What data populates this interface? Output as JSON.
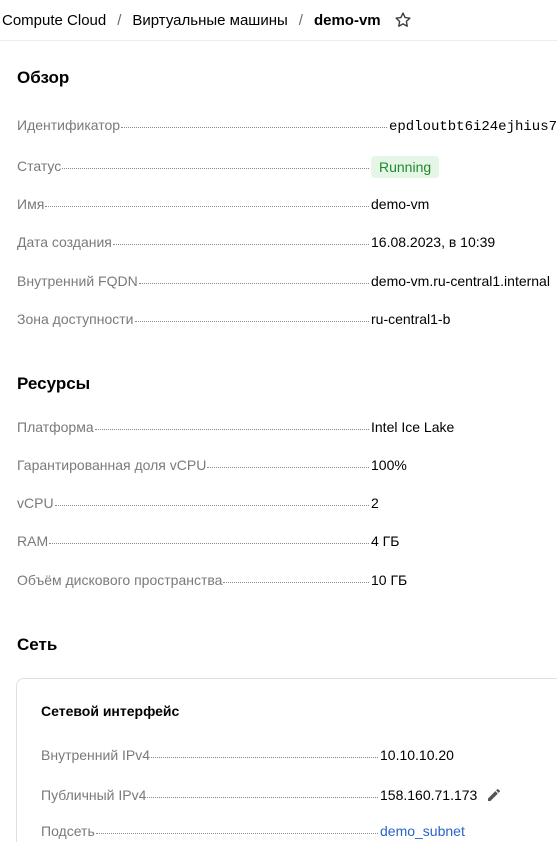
{
  "breadcrumb": {
    "items": [
      "Compute Cloud",
      "Виртуальные машины",
      "demo-vm"
    ],
    "separator": "/"
  },
  "overview": {
    "title": "Обзор",
    "rows": [
      {
        "label": "Идентификатор",
        "value": "epdloutbt6i24ejhius7"
      },
      {
        "label": "Статус",
        "value": "Running"
      },
      {
        "label": "Имя",
        "value": "demo-vm"
      },
      {
        "label": "Дата создания",
        "value": "16.08.2023, в 10:39"
      },
      {
        "label": "Внутренний FQDN",
        "value": "demo-vm.ru-central1.internal"
      },
      {
        "label": "Зона доступности",
        "value": "ru-central1-b"
      }
    ]
  },
  "resources": {
    "title": "Ресурсы",
    "rows": [
      {
        "label": "Платформа",
        "value": "Intel Ice Lake"
      },
      {
        "label": "Гарантированная доля vCPU",
        "value": "100%"
      },
      {
        "label": "vCPU",
        "value": "2"
      },
      {
        "label": "RAM",
        "value": "4 ГБ"
      },
      {
        "label": "Объём дискового пространства",
        "value": "10 ГБ"
      }
    ]
  },
  "network": {
    "title": "Сеть",
    "interface": {
      "title": "Сетевой интерфейс",
      "rows": [
        {
          "label": "Внутренний IPv4",
          "value": "10.10.10.20"
        },
        {
          "label": "Публичный IPv4",
          "value": "158.160.71.173"
        },
        {
          "label": "Подсеть",
          "value": "demo_subnet"
        }
      ]
    }
  },
  "icons": {
    "favorite": "star-outline-icon",
    "edit": "pencil-icon"
  },
  "colors": {
    "status_bg": "#e6f6e6",
    "status_text": "#1f8a2c",
    "link": "#2962c8",
    "label": "#7a7a7a"
  }
}
